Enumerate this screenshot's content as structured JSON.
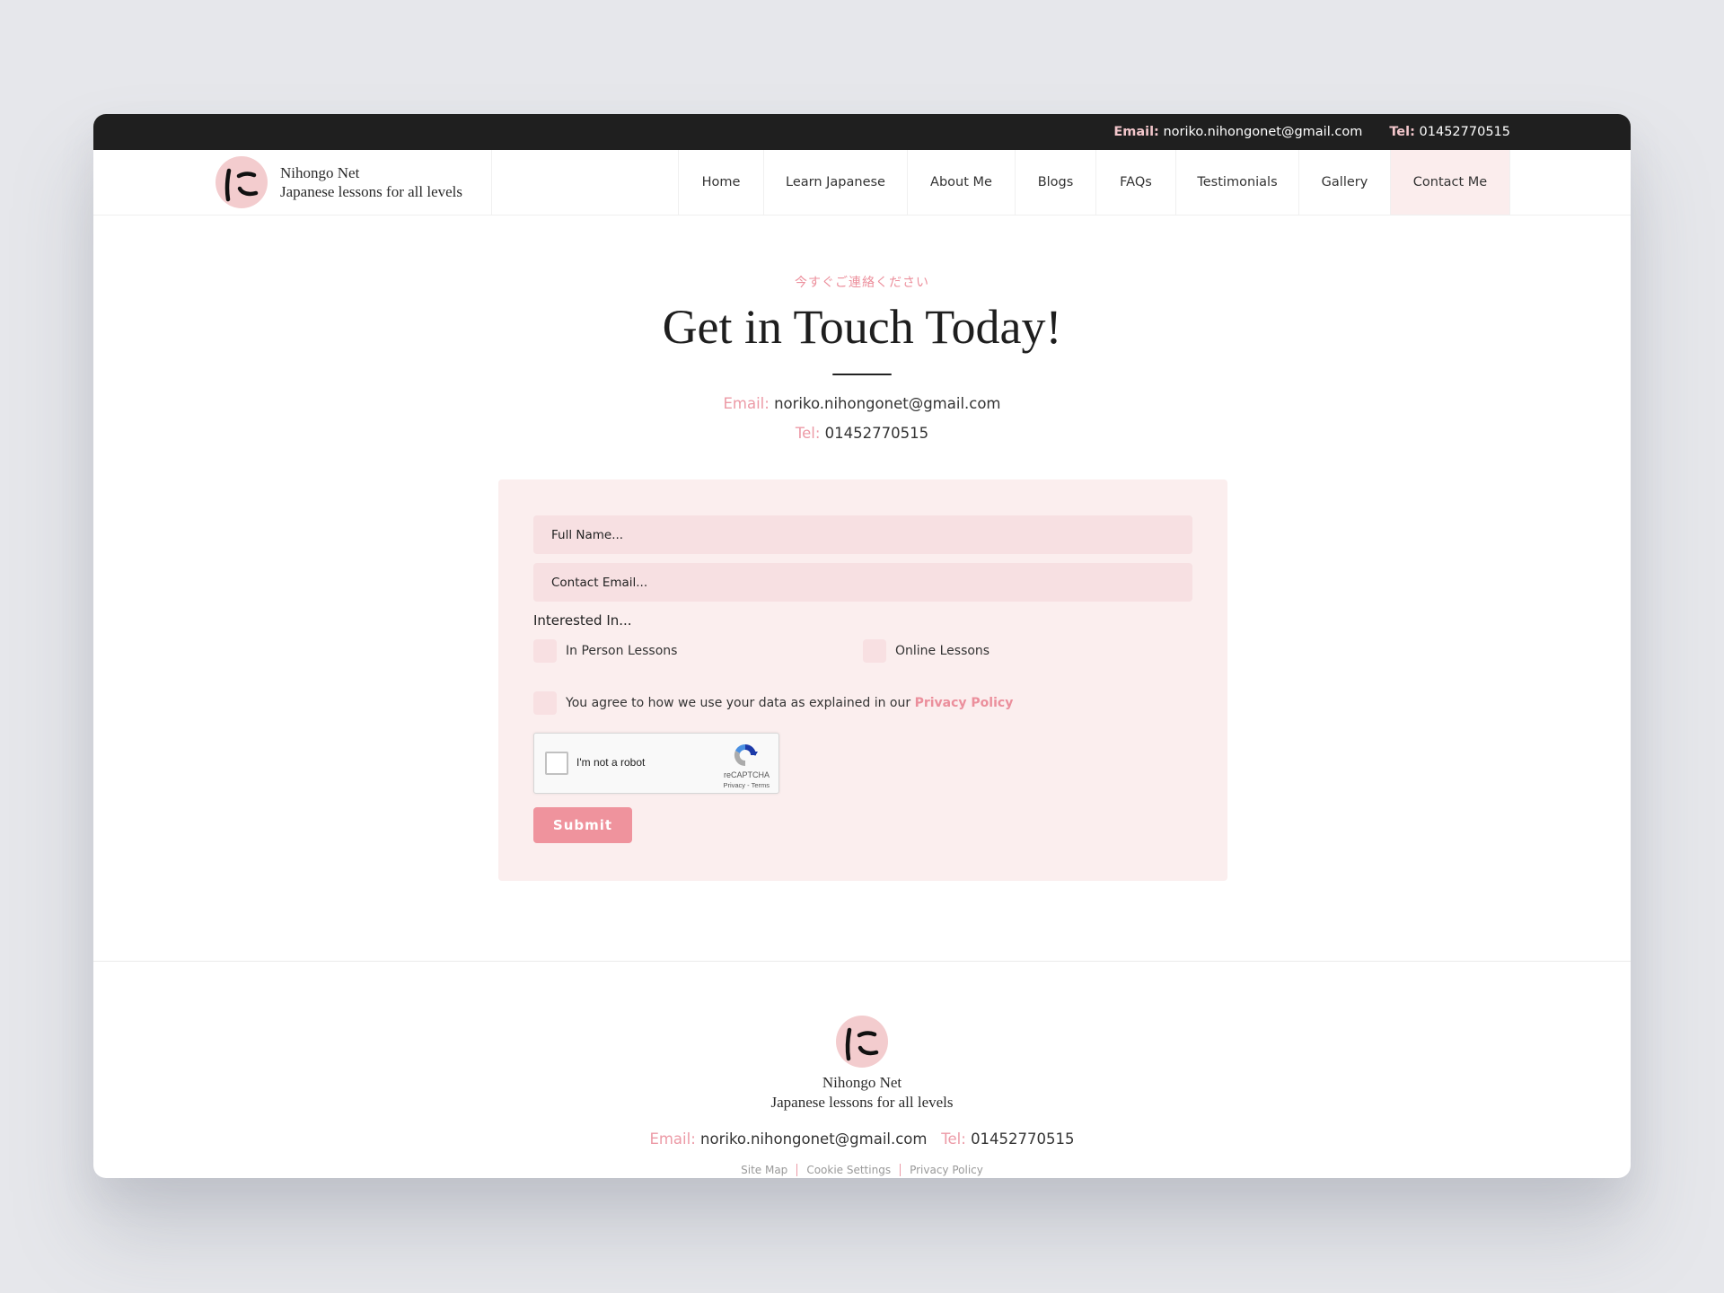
{
  "topbar": {
    "email_label": "Email:",
    "email": "noriko.nihongonet@gmail.com",
    "tel_label": "Tel:",
    "tel": "01452770515"
  },
  "brand": {
    "logo_glyph": "に",
    "name": "Nihongo Net",
    "tagline": "Japanese lessons for all levels",
    "logo_color": "#f3ccce"
  },
  "nav": {
    "items": [
      {
        "label": "Home"
      },
      {
        "label": "Learn Japanese"
      },
      {
        "label": "About Me"
      },
      {
        "label": "Blogs"
      },
      {
        "label": "FAQs"
      },
      {
        "label": "Testimonials"
      },
      {
        "label": "Gallery"
      },
      {
        "label": "Contact Me",
        "active": true
      }
    ]
  },
  "hero": {
    "kicker": "今すぐご連絡ください",
    "title": "Get in Touch Today!",
    "email_label": "Email:",
    "email": "noriko.nihongonet@gmail.com",
    "tel_label": "Tel:",
    "tel": "01452770515"
  },
  "form": {
    "name_placeholder": "Full Name...",
    "email_placeholder": "Contact Email...",
    "interest_label": "Interested In...",
    "options": [
      {
        "label": "In Person Lessons",
        "checked": false
      },
      {
        "label": "Online Lessons",
        "checked": false
      }
    ],
    "agree_text": "You agree to how we use your data as explained in our",
    "agree_link": "Privacy Policy",
    "agree_checked": false,
    "recaptcha": {
      "label": "I'm not a robot",
      "brand": "reCAPTCHA",
      "links": "Privacy - Terms"
    },
    "submit_label": "Submit"
  },
  "footer": {
    "name": "Nihongo Net",
    "tagline": "Japanese lessons for all levels",
    "email_label": "Email:",
    "email": "noriko.nihongonet@gmail.com",
    "tel_label": "Tel:",
    "tel": "01452770515",
    "links": [
      "Site Map",
      "Cookie Settings",
      "Privacy Policy"
    ]
  },
  "colors": {
    "accent": "#ec8f9c",
    "topbar_bg": "#1f1f1f",
    "form_bg": "#fbeeee",
    "field_bg": "#f7e0e2",
    "submit_bg": "#ef939d"
  }
}
